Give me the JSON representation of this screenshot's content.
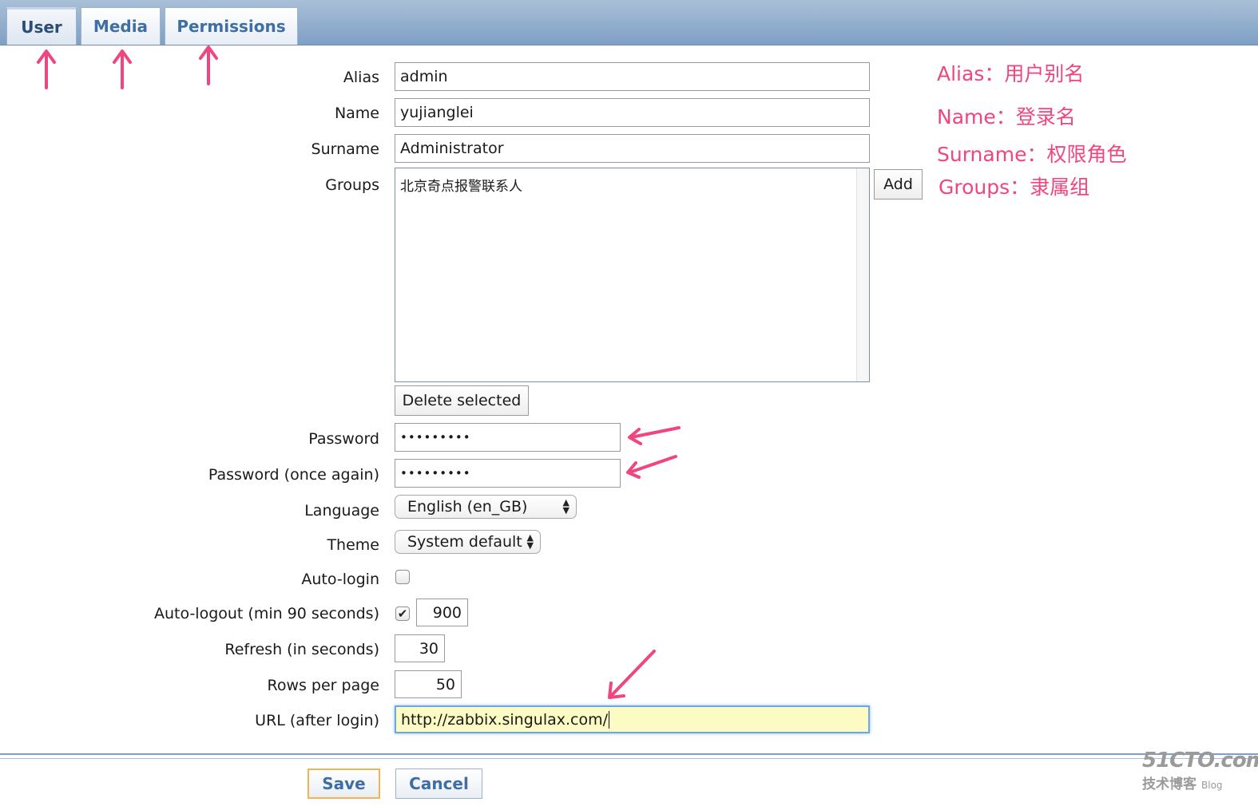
{
  "tabs": [
    {
      "label": "User",
      "active": true
    },
    {
      "label": "Media",
      "active": false
    },
    {
      "label": "Permissions",
      "active": false
    }
  ],
  "form": {
    "alias": {
      "label": "Alias",
      "value": "admin"
    },
    "name": {
      "label": "Name",
      "value": "yujianglei"
    },
    "surname": {
      "label": "Surname",
      "value": "Administrator"
    },
    "groups": {
      "label": "Groups",
      "items": [
        "北京奇点报警联系人"
      ],
      "add_label": "Add",
      "delete_label": "Delete selected"
    },
    "password": {
      "label": "Password",
      "value": "•••••••••"
    },
    "password_again": {
      "label": "Password (once again)",
      "value": "•••••••••"
    },
    "language": {
      "label": "Language",
      "value": "English (en_GB)"
    },
    "theme": {
      "label": "Theme",
      "value": "System default"
    },
    "auto_login": {
      "label": "Auto-login",
      "checked": false
    },
    "auto_logout": {
      "label": "Auto-logout (min 90 seconds)",
      "checked": true,
      "value": "900"
    },
    "refresh": {
      "label": "Refresh (in seconds)",
      "value": "30"
    },
    "rows_per_page": {
      "label": "Rows per page",
      "value": "50"
    },
    "url": {
      "label": "URL (after login)",
      "value": "http://zabbix.singulax.com/"
    }
  },
  "actions": {
    "save_label": "Save",
    "cancel_label": "Cancel"
  },
  "annotations": {
    "alias": "Alias：用户别名",
    "name": "Name：登录名",
    "surname": "Surname：权限角色",
    "groups": "Groups：隶属组"
  },
  "watermark": {
    "line1": "51CTO.com",
    "line2": "技术博客",
    "blog": "Blog"
  },
  "colors": {
    "accent": "#3e6ea4",
    "annotation": "#f0457f",
    "url_highlight": "#fdfbc4"
  }
}
